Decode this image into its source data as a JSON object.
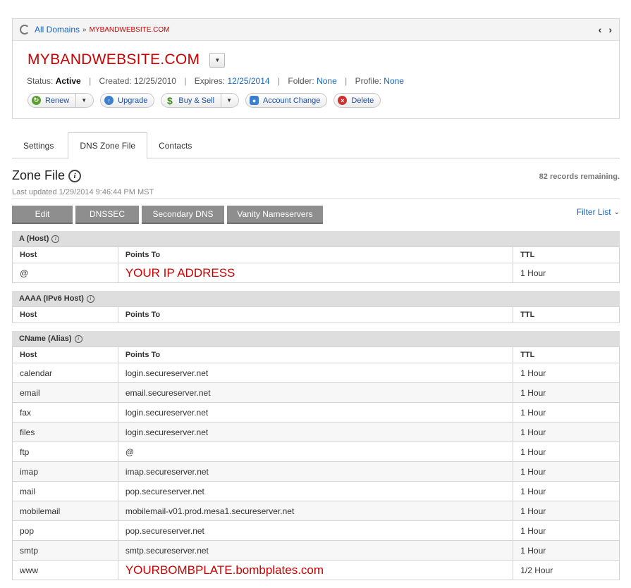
{
  "breadcrumb": {
    "all_domains": "All Domains",
    "sep": "»",
    "current": "MYBANDWEBSITE.COM"
  },
  "domain": {
    "title": "MYBANDWEBSITE.COM",
    "status_label": "Status:",
    "status_value": "Active",
    "created_label": "Created:",
    "created_value": "12/25/2010",
    "expires_label": "Expires:",
    "expires_value": "12/25/2014",
    "folder_label": "Folder:",
    "folder_value": "None",
    "profile_label": "Profile:",
    "profile_value": "None"
  },
  "actions": {
    "renew": "Renew",
    "upgrade": "Upgrade",
    "buy_sell": "Buy & Sell",
    "account_change": "Account Change",
    "delete": "Delete"
  },
  "tabs": [
    "Settings",
    "DNS Zone File",
    "Contacts"
  ],
  "zone": {
    "title": "Zone File",
    "records_remaining": "82 records remaining.",
    "last_updated": "Last updated 1/29/2014 9:46:44 PM MST"
  },
  "toolbar": {
    "edit": "Edit",
    "dnssec": "DNSSEC",
    "secondary_dns": "Secondary DNS",
    "vanity": "Vanity Nameservers",
    "filter_list": "Filter List"
  },
  "columns": {
    "host": "Host",
    "points_to": "Points To",
    "ttl": "TTL"
  },
  "sections": {
    "a": {
      "title": "A (Host)",
      "rows": [
        {
          "host": "@",
          "points_to": "YOUR IP ADDRESS",
          "ttl": "1 Hour"
        }
      ]
    },
    "aaaa": {
      "title": "AAAA (IPv6 Host)"
    },
    "cname": {
      "title": "CName (Alias)",
      "rows": [
        {
          "host": "calendar",
          "points_to": "login.secureserver.net",
          "ttl": "1 Hour"
        },
        {
          "host": "email",
          "points_to": "email.secureserver.net",
          "ttl": "1 Hour"
        },
        {
          "host": "fax",
          "points_to": "login.secureserver.net",
          "ttl": "1 Hour"
        },
        {
          "host": "files",
          "points_to": "login.secureserver.net",
          "ttl": "1 Hour"
        },
        {
          "host": "ftp",
          "points_to": "@",
          "ttl": "1 Hour"
        },
        {
          "host": "imap",
          "points_to": "imap.secureserver.net",
          "ttl": "1 Hour"
        },
        {
          "host": "mail",
          "points_to": "pop.secureserver.net",
          "ttl": "1 Hour"
        },
        {
          "host": "mobilemail",
          "points_to": "mobilemail-v01.prod.mesa1.secureserver.net",
          "ttl": "1 Hour"
        },
        {
          "host": "pop",
          "points_to": "pop.secureserver.net",
          "ttl": "1 Hour"
        },
        {
          "host": "smtp",
          "points_to": "smtp.secureserver.net",
          "ttl": "1 Hour"
        },
        {
          "host": "www",
          "points_to": "YOURBOMBPLATE.bombplates.com",
          "ttl": "1/2 Hour"
        }
      ]
    }
  },
  "colors": {
    "accent_red": "#cc0000",
    "link_blue": "#1565c0",
    "button_gray": "#8e8e8e"
  }
}
